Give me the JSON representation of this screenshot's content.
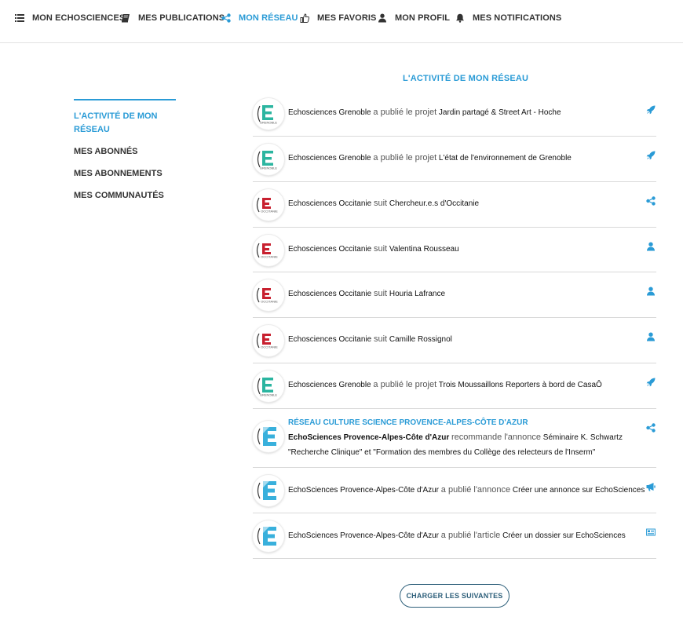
{
  "nav": {
    "items": [
      {
        "label": "MON ECHOSCIENCES",
        "icon": "list-icon"
      },
      {
        "label": "MES PUBLICATIONS",
        "icon": "book-icon"
      },
      {
        "label": "MON RÉSEAU",
        "icon": "share-icon",
        "active": true
      },
      {
        "label": "MES FAVORIS",
        "icon": "thumbs-up-icon"
      },
      {
        "label": "MON PROFIL",
        "icon": "user-icon"
      },
      {
        "label": "MES NOTIFICATIONS",
        "icon": "bell-icon"
      }
    ]
  },
  "colors": {
    "accent": "#2a9bd6",
    "text": "#333333",
    "button_border": "#2d5f7a",
    "grenoble_teal": "#2bb5a0",
    "occitanie_red": "#c8202f",
    "paca_blue": "#39b0dc"
  },
  "section_title": "L'ACTIVITÉ DE MON RÉSEAU",
  "sidebar": {
    "items": [
      {
        "label": "L'ACTIVITÉ DE MON RÉSEAU",
        "active": true
      },
      {
        "label": "MES ABONNÉS"
      },
      {
        "label": "MES ABONNEMENTS"
      },
      {
        "label": "MES COMMUNAUTÉS"
      }
    ]
  },
  "feed": [
    {
      "avatar": "grenoble",
      "avatar_label": "GRENOBLE",
      "actor": "Echosciences Grenoble",
      "verb": "a publié le projet",
      "object": "Jardin partagé & Street Art - Hoche",
      "icon": "rocket-icon"
    },
    {
      "avatar": "grenoble",
      "avatar_label": "GRENOBLE",
      "actor": "Echosciences Grenoble",
      "verb": "a publié le projet",
      "object": "L'état de l'environnement de Grenoble",
      "icon": "rocket-icon"
    },
    {
      "avatar": "occitanie",
      "avatar_label": "OCCITANIE",
      "actor": "Echosciences Occitanie",
      "verb": "suit",
      "object": "Chercheur.e.s d'Occitanie",
      "icon": "share-icon"
    },
    {
      "avatar": "occitanie",
      "avatar_label": "OCCITANIE",
      "actor": "Echosciences Occitanie",
      "verb": "suit",
      "object": "Valentina Rousseau",
      "icon": "user-icon"
    },
    {
      "avatar": "occitanie",
      "avatar_label": "OCCITANIE",
      "actor": "Echosciences Occitanie",
      "verb": "suit",
      "object": "Houria Lafrance",
      "icon": "user-icon"
    },
    {
      "avatar": "occitanie",
      "avatar_label": "OCCITANIE",
      "actor": "Echosciences Occitanie",
      "verb": "suit",
      "object": "Camille Rossignol",
      "icon": "user-icon"
    },
    {
      "avatar": "grenoble",
      "avatar_label": "GRENOBLE",
      "actor": "Echosciences Grenoble",
      "verb": "a publié le projet",
      "object": "Trois Moussaillons Reporters à bord de CasaÔ",
      "icon": "rocket-icon"
    },
    {
      "avatar": "paca",
      "group": "RÉSEAU CULTURE SCIENCE PROVENCE-ALPES-CÔTE D'AZUR",
      "actor": "EchoSciences Provence-Alpes-Côte d'Azur",
      "verb": "recommande l'annonce",
      "object": "Séminaire K. Schwartz",
      "object_line2": "\"Recherche Clinique\" et \"Formation des membres du Collège des relecteurs de l'Inserm\"",
      "icon": "share-icon"
    },
    {
      "avatar": "paca",
      "actor": "EchoSciences Provence-Alpes-Côte d'Azur",
      "verb": "a publié l'annonce",
      "object": "Créer une annonce sur EchoSciences",
      "icon": "megaphone-icon"
    },
    {
      "avatar": "paca",
      "actor": "EchoSciences Provence-Alpes-Côte d'Azur",
      "verb": "a publié l'article",
      "object": "Créer un dossier sur EchoSciences",
      "icon": "newspaper-icon"
    }
  ],
  "load_more_label": "CHARGER LES SUIVANTES"
}
